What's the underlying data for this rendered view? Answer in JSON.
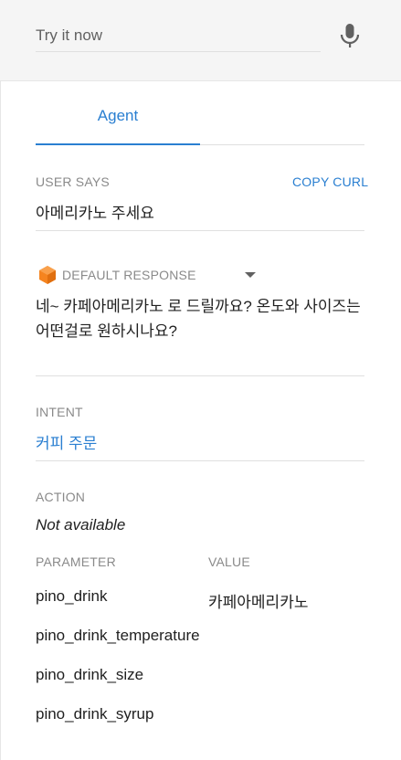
{
  "search": {
    "placeholder": "Try it now"
  },
  "tab": {
    "label": "Agent"
  },
  "user_says": {
    "label": "USER SAYS",
    "copy_label": "COPY CURL",
    "value": "아메리카노 주세요"
  },
  "response": {
    "label": "DEFAULT RESPONSE",
    "text": "네~ 카페아메리카노 로 드릴까요? 온도와 사이즈는 어떤걸로 원하시나요?"
  },
  "intent": {
    "label": "INTENT",
    "value": "커피 주문"
  },
  "action": {
    "label": "ACTION",
    "value": "Not available"
  },
  "params": {
    "param_header": "PARAMETER",
    "value_header": "VALUE",
    "rows": [
      {
        "name": "pino_drink",
        "value": "카페아메리카노"
      },
      {
        "name": "pino_drink_temperature",
        "value": ""
      },
      {
        "name": "pino_drink_size",
        "value": ""
      },
      {
        "name": "pino_drink_syrup",
        "value": ""
      }
    ]
  },
  "colors": {
    "accent": "#2a7fd1",
    "icon_orange": "#f5841f"
  },
  "icons": {
    "mic": "mic-icon",
    "response": "dialogflow-cube-icon",
    "dropdown": "caret-down-icon"
  }
}
